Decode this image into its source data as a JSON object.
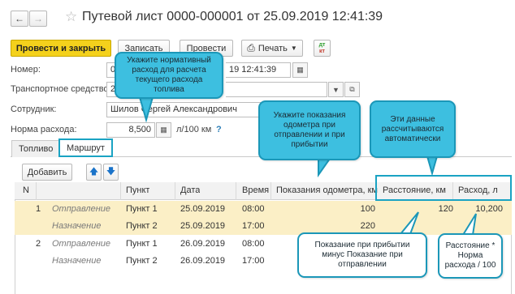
{
  "window": {
    "title": "Путевой лист 0000-000001 от 25.09.2019 12:41:39"
  },
  "toolbar": {
    "post_close": "Провести и закрыть",
    "save": "Записать",
    "post": "Провести",
    "print": "Печать",
    "dt_kt_top": "дт",
    "dt_kt_bottom": "кт"
  },
  "form": {
    "number_label": "Номер:",
    "number_value": "0",
    "date_value": "19 12:41:39",
    "vehicle_label": "Транспортное средство:",
    "vehicle_value": "22",
    "employee_label": "Сотрудник:",
    "employee_value": "Шилов Сергей Александрович",
    "norm_label": "Норма расхода:",
    "norm_value": "8,500",
    "norm_unit": "л/100 км",
    "help": "?"
  },
  "tabs": [
    "Топливо",
    "Маршрут"
  ],
  "route": {
    "add_button": "Добавить",
    "columns": [
      "N",
      "",
      "Пункт",
      "Дата",
      "Время",
      "Показания одометра, км",
      "Расстояние, км",
      "Расход, л"
    ],
    "rows": [
      {
        "n": "1",
        "type": "Отправление",
        "point": "Пункт 1",
        "date": "25.09.2019",
        "time": "08:00",
        "odometer": "100",
        "distance": "120",
        "consumption": "10,200"
      },
      {
        "n": "",
        "type": "Назначение",
        "point": "Пункт 2",
        "date": "25.09.2019",
        "time": "17:00",
        "odometer": "220",
        "distance": "",
        "consumption": ""
      },
      {
        "n": "2",
        "type": "Отправление",
        "point": "Пункт 1",
        "date": "26.09.2019",
        "time": "08:00",
        "odometer": "",
        "distance": "",
        "consumption": ""
      },
      {
        "n": "",
        "type": "Назначение",
        "point": "Пункт 2",
        "date": "26.09.2019",
        "time": "17:00",
        "odometer": "",
        "distance": "",
        "consumption": ""
      }
    ]
  },
  "callouts": {
    "norm": "Укажите нормативный расход для расчета текущего расхода топлива",
    "odometer": "Укажите показания одометра при отправлении и при прибытии",
    "auto": "Эти данные рассчитываются автоматически",
    "distance": "Показание при прибытии минус Показание при отправлении",
    "consumption": "Расстояние * Норма расхода / 100"
  },
  "colors": {
    "primary_button": "#f4d11c",
    "callout": "#3dbfe0",
    "highlight": "#1aa3c3",
    "selected_row": "#fbefc6"
  }
}
